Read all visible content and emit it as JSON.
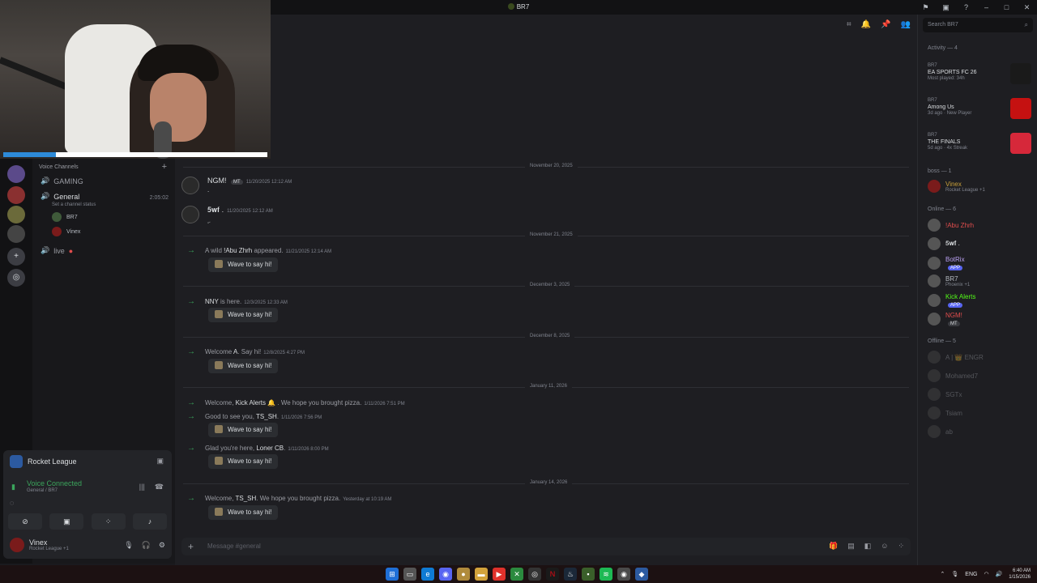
{
  "window": {
    "title": "BR7",
    "search_placeholder": "Search BR7"
  },
  "channels": {
    "header": "Voice Channels",
    "gaming": "GAMING",
    "general": "General",
    "timer": "2:05:02",
    "set_status": "Set a channel status",
    "voice_users": [
      "BR7",
      "Vinex"
    ],
    "live": "live"
  },
  "panel": {
    "game": "Rocket League",
    "voice_connected": "Voice Connected",
    "voice_sub": "General / BR7",
    "user_name": "Vinex",
    "user_status": "Rocket League +1"
  },
  "chat": {
    "dividers": [
      "November 20, 2025",
      "November 21, 2025",
      "December 3, 2025",
      "December 8, 2025",
      "January 11, 2026",
      "January 14, 2026"
    ],
    "messages": [
      {
        "name": "NGM!",
        "tag": "MT",
        "ts": "11/20/2025 12:12 AM",
        "text": "."
      },
      {
        "name": "𝟓𝐰𝐟 .",
        "ts": "11/20/2025 12:12 AM",
        "text": "ۣ"
      }
    ],
    "sys": [
      {
        "pre": "A wild ",
        "name": "!Abu Zhrh",
        "post": " appeared.",
        "ts": "11/21/2025 12:14 AM"
      },
      {
        "pre": "",
        "name": "NNY",
        "post": " is here.",
        "ts": "12/3/2025 12:33 AM"
      },
      {
        "pre": "Welcome ",
        "name": "A",
        "post": ". Say hi!",
        "ts": "12/8/2025 4:27 PM"
      },
      {
        "pre": "Welcome, ",
        "name": "Kick Alerts",
        "post": " 🔔 . We hope you brought pizza.",
        "ts": "1/11/2026 7:51 PM"
      },
      {
        "pre": "Good to see you, ",
        "name": "TS_SH",
        "post": ".",
        "ts": "1/11/2026 7:56 PM"
      },
      {
        "pre": "Glad you're here, ",
        "name": "Loner CB",
        "post": ".",
        "ts": "1/11/2026 8:00 PM"
      },
      {
        "pre": "Welcome, ",
        "name": "TS_SH",
        "post": ". We hope you brought pizza.",
        "ts": "Yesterday at 10:19 AM"
      }
    ],
    "wave": "Wave to say hi!",
    "composer_placeholder": "Message #general"
  },
  "members": {
    "activity_header": "Activity — 4",
    "activities": [
      {
        "user": "BR7",
        "game": "EA SPORTS FC 26",
        "detail": "Most played: 34h",
        "color": "#1a1a1a"
      },
      {
        "user": "BR7",
        "game": "Among Us",
        "detail": "3d ago · New Player",
        "color": "#c51111"
      },
      {
        "user": "BR7",
        "game": "THE FINALS",
        "detail": "5d ago · 4x Streak",
        "color": "#d6283a"
      }
    ],
    "boss_header": "boss — 1",
    "boss": [
      {
        "name": "Vinex",
        "status": "Rocket League +1"
      }
    ],
    "online_header": "Online — 6",
    "online": [
      {
        "name": "!Abu Zhrh",
        "status": "",
        "tag": "",
        "color": "#e04d4d"
      },
      {
        "name": "𝟓𝐰𝐟 .",
        "status": "",
        "tag": "",
        "color": "#dbdee1"
      },
      {
        "name": "BotRix",
        "status": "",
        "tag": "APP",
        "color": "#b9a0f0"
      },
      {
        "name": "BR7",
        "status": "Phoenix +1",
        "tag": "",
        "color": "#b5bac1"
      },
      {
        "name": "Kick Alerts",
        "status": "",
        "tag": "APP",
        "color": "#53fc18"
      },
      {
        "name": "NGM!",
        "status": "",
        "tag": "MT",
        "color": "#e04d4d"
      }
    ],
    "offline_header": "Offline — 5",
    "offline": [
      "A | 👑 ENGR",
      "Mohamed7",
      "SGTx",
      "Tsiam",
      "ab"
    ]
  },
  "taskbar": {
    "lang": "ENG",
    "time": "6:40 AM",
    "date": "1/15/2026"
  }
}
